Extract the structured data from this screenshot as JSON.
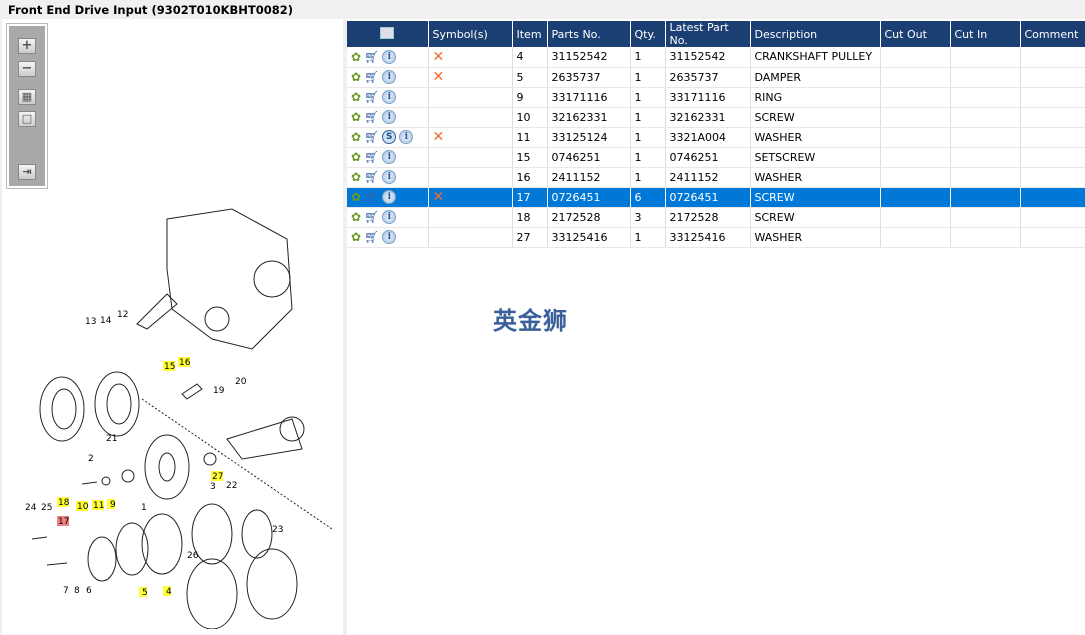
{
  "title": "Front End Drive Input (9302T010KBHT0082)",
  "toolbar": {
    "zoom_in": "+",
    "zoom_out": "−",
    "fit": "▦",
    "actual": "□",
    "export": "⇥"
  },
  "watermark": "英金狮",
  "columns": [
    "",
    "Symbol(s)",
    "Item",
    "Parts No.",
    "Qty.",
    "Latest Part No.",
    "Description",
    "Cut Out",
    "Cut In",
    "Comment"
  ],
  "rows": [
    {
      "s": false,
      "x": true,
      "item": "4",
      "part": "31152542",
      "qty": "1",
      "latest": "31152542",
      "desc": "CRANKSHAFT PULLEY",
      "cut_out": "",
      "cut_in": "",
      "comment": ""
    },
    {
      "s": false,
      "x": true,
      "item": "5",
      "part": "2635737",
      "qty": "1",
      "latest": "2635737",
      "desc": "DAMPER",
      "cut_out": "",
      "cut_in": "",
      "comment": ""
    },
    {
      "s": false,
      "x": false,
      "item": "9",
      "part": "33171116",
      "qty": "1",
      "latest": "33171116",
      "desc": "RING",
      "cut_out": "",
      "cut_in": "",
      "comment": ""
    },
    {
      "s": false,
      "x": false,
      "item": "10",
      "part": "32162331",
      "qty": "1",
      "latest": "32162331",
      "desc": "SCREW",
      "cut_out": "",
      "cut_in": "",
      "comment": ""
    },
    {
      "s": true,
      "x": true,
      "item": "11",
      "part": "33125124",
      "qty": "1",
      "latest": "3321A004",
      "desc": "WASHER",
      "cut_out": "",
      "cut_in": "",
      "comment": ""
    },
    {
      "s": false,
      "x": false,
      "item": "15",
      "part": "0746251",
      "qty": "1",
      "latest": "0746251",
      "desc": "SETSCREW",
      "cut_out": "",
      "cut_in": "",
      "comment": ""
    },
    {
      "s": false,
      "x": false,
      "item": "16",
      "part": "2411152",
      "qty": "1",
      "latest": "2411152",
      "desc": "WASHER",
      "cut_out": "",
      "cut_in": "",
      "comment": ""
    },
    {
      "s": false,
      "x": true,
      "item": "17",
      "part": "0726451",
      "qty": "6",
      "latest": "0726451",
      "desc": "SCREW",
      "cut_out": "",
      "cut_in": "",
      "comment": "",
      "selected": true
    },
    {
      "s": false,
      "x": false,
      "item": "18",
      "part": "2172528",
      "qty": "3",
      "latest": "2172528",
      "desc": "SCREW",
      "cut_out": "",
      "cut_in": "",
      "comment": ""
    },
    {
      "s": false,
      "x": false,
      "item": "27",
      "part": "33125416",
      "qty": "1",
      "latest": "33125416",
      "desc": "WASHER",
      "cut_out": "",
      "cut_in": "",
      "comment": ""
    }
  ],
  "callouts": [
    {
      "n": "13",
      "hl": ""
    },
    {
      "n": "14",
      "hl": ""
    },
    {
      "n": "12",
      "hl": ""
    },
    {
      "n": "15",
      "hl": "y"
    },
    {
      "n": "16",
      "hl": "y"
    },
    {
      "n": "19",
      "hl": ""
    },
    {
      "n": "20",
      "hl": ""
    },
    {
      "n": "2",
      "hl": ""
    },
    {
      "n": "21",
      "hl": ""
    },
    {
      "n": "27",
      "hl": "y"
    },
    {
      "n": "1",
      "hl": ""
    },
    {
      "n": "3",
      "hl": ""
    },
    {
      "n": "22",
      "hl": ""
    },
    {
      "n": "10",
      "hl": "y"
    },
    {
      "n": "11",
      "hl": "y"
    },
    {
      "n": "9",
      "hl": "y"
    },
    {
      "n": "18",
      "hl": "y"
    },
    {
      "n": "24",
      "hl": ""
    },
    {
      "n": "25",
      "hl": ""
    },
    {
      "n": "17",
      "hl": "r"
    },
    {
      "n": "26",
      "hl": ""
    },
    {
      "n": "23",
      "hl": ""
    },
    {
      "n": "7",
      "hl": ""
    },
    {
      "n": "8",
      "hl": ""
    },
    {
      "n": "6",
      "hl": ""
    },
    {
      "n": "5",
      "hl": "y"
    },
    {
      "n": "4",
      "hl": "y"
    }
  ]
}
